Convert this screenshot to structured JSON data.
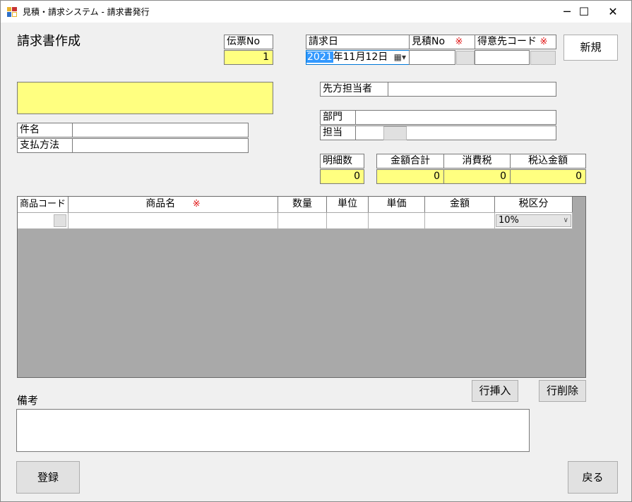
{
  "window": {
    "title": "見積・請求システム - 請求書発行",
    "minimize": "─",
    "maximize": "☐",
    "close": "✕"
  },
  "heading": "請求書作成",
  "slip": {
    "label": "伝票No",
    "value": "1"
  },
  "invoice_date": {
    "label": "請求日",
    "year": "2021",
    "rest": "年11月12日",
    "picker_glyph": "▦▾"
  },
  "estimate_no": {
    "label": "見積No",
    "mark": "※"
  },
  "customer_code": {
    "label": "得意先コード",
    "mark": "※"
  },
  "new_button": "新規",
  "customer_name": "",
  "contact": {
    "label": "先方担当者",
    "value": ""
  },
  "subject": {
    "label": "件名",
    "value": ""
  },
  "payment": {
    "label": "支払方法",
    "value": ""
  },
  "department": {
    "label": "部門",
    "value": ""
  },
  "staff": {
    "label": "担当",
    "value": ""
  },
  "line_count": {
    "label": "明細数",
    "value": "0"
  },
  "totals": {
    "amount_label": "金額合計",
    "amount": "0",
    "tax_label": "消費税",
    "tax": "0",
    "incl_label": "税込金額",
    "incl": "0"
  },
  "table": {
    "headers": {
      "code": "商品コード",
      "name": "商品名",
      "name_mark": "※",
      "qty": "数量",
      "unit": "単位",
      "price": "単価",
      "amount": "金額",
      "tax": "税区分"
    },
    "rows": [
      {
        "code": "",
        "name": "",
        "qty": "",
        "unit": "",
        "price": "",
        "amount": "",
        "tax": "10%"
      }
    ]
  },
  "insert_row_button": "行挿入",
  "delete_row_button": "行削除",
  "remarks": {
    "label": "備考",
    "value": ""
  },
  "register_button": "登録",
  "back_button": "戻る",
  "colors": {
    "highlight": "#ffff80",
    "required": "#e01010",
    "grid_bg": "#a9a9a9",
    "date_select": "#3399ff"
  }
}
